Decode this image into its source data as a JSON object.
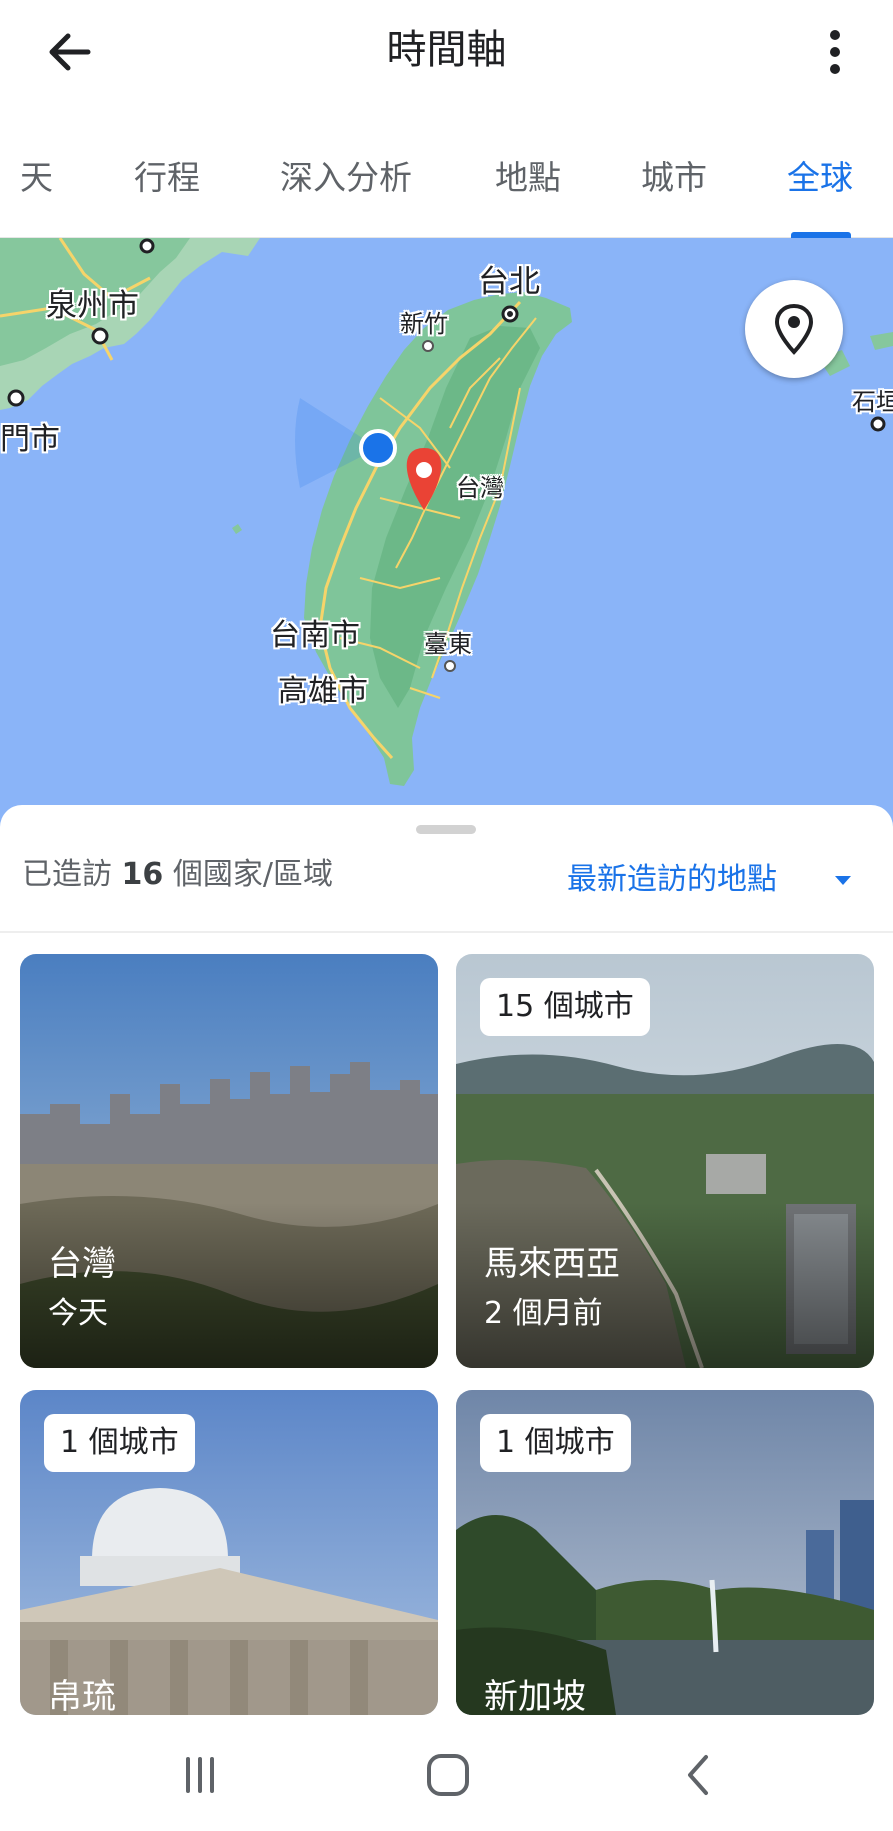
{
  "appbar": {
    "title": "時間軸",
    "back_icon": "arrow-left-icon",
    "more_icon": "more-vert-icon"
  },
  "tabs": [
    {
      "label": "天",
      "active": false
    },
    {
      "label": "行程",
      "active": false
    },
    {
      "label": "深入分析",
      "active": false
    },
    {
      "label": "地點",
      "active": false
    },
    {
      "label": "城市",
      "active": false
    },
    {
      "label": "全球",
      "active": true
    }
  ],
  "map": {
    "labels": {
      "quanzhou": "泉州市",
      "kinmen": "門市",
      "taipei": "台北",
      "hsinchu": "新竹",
      "taiwan": "台灣",
      "tainan": "台南市",
      "kaohsiung": "高雄市",
      "taitung": "臺東",
      "ishigaki": "石垣"
    },
    "location_button_icon": "map-pin-outline-icon",
    "colors": {
      "water": "#8ab4f8",
      "land": "#7fc59a",
      "road": "#f6d46a",
      "marker": "#ea4335",
      "user_dot": "#1a73e8"
    }
  },
  "sheet": {
    "summary_prefix": "已造訪 ",
    "summary_count": "16",
    "summary_suffix": " 個國家/區域",
    "sort_label": "最新造訪的地點",
    "sort_icon": "caret-down-icon"
  },
  "cards": [
    {
      "name": "台灣",
      "subtitle": "今天",
      "chip": ""
    },
    {
      "name": "馬來西亞",
      "subtitle": "2 個月前",
      "chip": "15 個城市"
    },
    {
      "name": "帛琉",
      "subtitle": "",
      "chip": "1 個城市"
    },
    {
      "name": "新加坡",
      "subtitle": "",
      "chip": "1 個城市"
    }
  ],
  "navbar": {
    "recents_icon": "recent-apps-icon",
    "home_icon": "home-icon",
    "back_icon": "chevron-left-icon"
  }
}
